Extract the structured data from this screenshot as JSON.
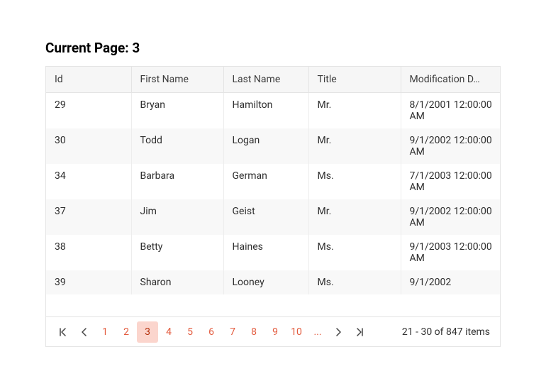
{
  "heading_prefix": "Current Page: ",
  "current_page": "3",
  "columns": [
    {
      "key": "id",
      "label": "Id"
    },
    {
      "key": "first",
      "label": "First Name"
    },
    {
      "key": "last",
      "label": "Last Name"
    },
    {
      "key": "title",
      "label": "Title"
    },
    {
      "key": "mod",
      "label": "Modification D…"
    }
  ],
  "rows": [
    {
      "id": "29",
      "first": "Bryan",
      "last": "Hamilton",
      "title": "Mr.",
      "mod": "8/1/2001 12:00:00 AM"
    },
    {
      "id": "30",
      "first": "Todd",
      "last": "Logan",
      "title": "Mr.",
      "mod": "9/1/2002 12:00:00 AM"
    },
    {
      "id": "34",
      "first": "Barbara",
      "last": "German",
      "title": "Ms.",
      "mod": "7/1/2003 12:00:00 AM"
    },
    {
      "id": "37",
      "first": "Jim",
      "last": "Geist",
      "title": "Mr.",
      "mod": "9/1/2002 12:00:00 AM"
    },
    {
      "id": "38",
      "first": "Betty",
      "last": "Haines",
      "title": "Ms.",
      "mod": "9/1/2003 12:00:00 AM"
    },
    {
      "id": "39",
      "first": "Sharon",
      "last": "Looney",
      "title": "Ms.",
      "mod": "9/1/2002"
    }
  ],
  "pager": {
    "pages": [
      "1",
      "2",
      "3",
      "4",
      "5",
      "6",
      "7",
      "8",
      "9",
      "10"
    ],
    "ellipsis": "...",
    "selected_index": 2,
    "info": "21 - 30 of 847 items"
  },
  "icons": {
    "first": "first-page-icon",
    "prev": "prev-page-icon",
    "next": "next-page-icon",
    "last": "last-page-icon"
  }
}
